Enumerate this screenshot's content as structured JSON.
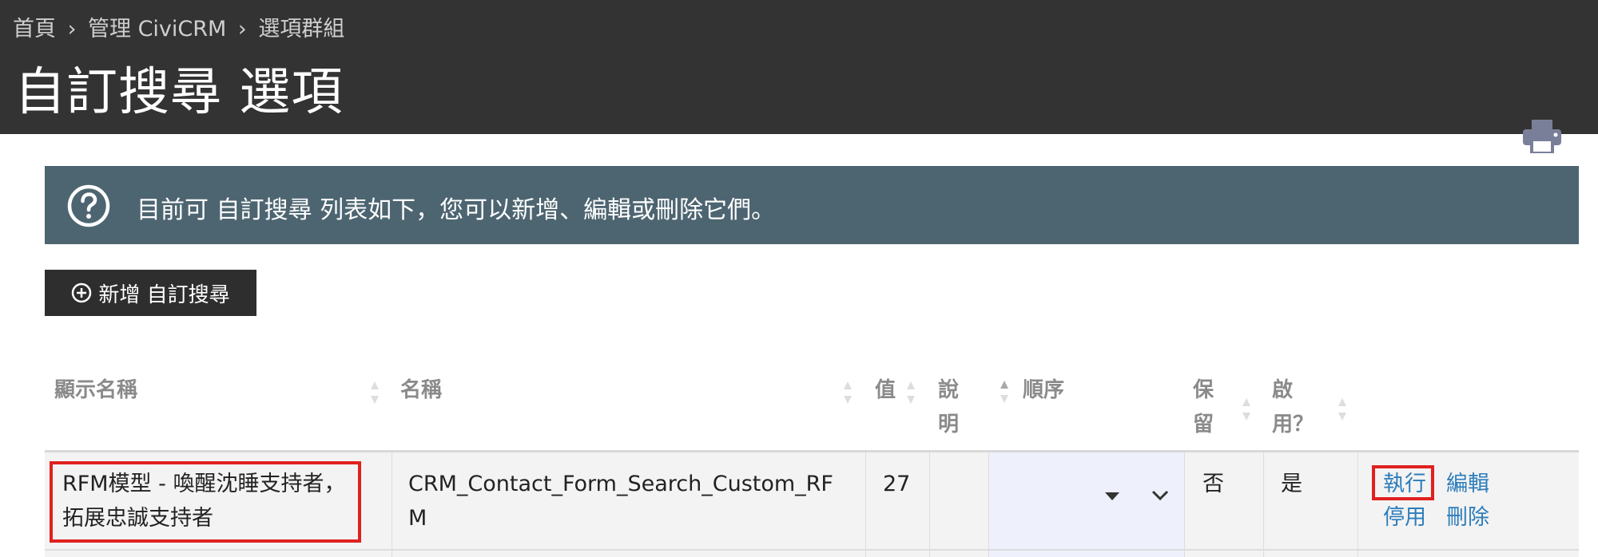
{
  "breadcrumb": {
    "items": [
      "首頁",
      "管理 CiviCRM",
      "選項群組"
    ],
    "separator": "›"
  },
  "page": {
    "title": "自訂搜尋 選項"
  },
  "help": {
    "text": "目前可 自訂搜尋 列表如下，您可以新增、編輯或刪除它們。"
  },
  "actions": {
    "add_label": "新增 自訂搜尋"
  },
  "table": {
    "headers": {
      "label": "顯示名稱",
      "name": "名稱",
      "value": "值",
      "description_l1": "說",
      "description_l2": "明",
      "order": "順序",
      "reserved_l1": "保",
      "reserved_l2": "留",
      "enabled_l1": "啟",
      "enabled_l2": "用？"
    },
    "rows": [
      {
        "label_l1": "RFM模型 - 喚醒沈睡支持者，",
        "label_l2": "拓展忠誠支持者",
        "name_l1": "CRM_Contact_Form_Search_Custom_RF",
        "name_l2": "M",
        "value": "27",
        "description": "",
        "reserved": "否",
        "enabled": "是",
        "links": {
          "run": "執行",
          "edit": "編輯",
          "disable": "停用",
          "delete": "刪除"
        }
      }
    ]
  },
  "colors": {
    "header_bg": "#333333",
    "help_bg": "#4d6571",
    "link": "#2c7dbb",
    "highlight": "#e0211f"
  }
}
